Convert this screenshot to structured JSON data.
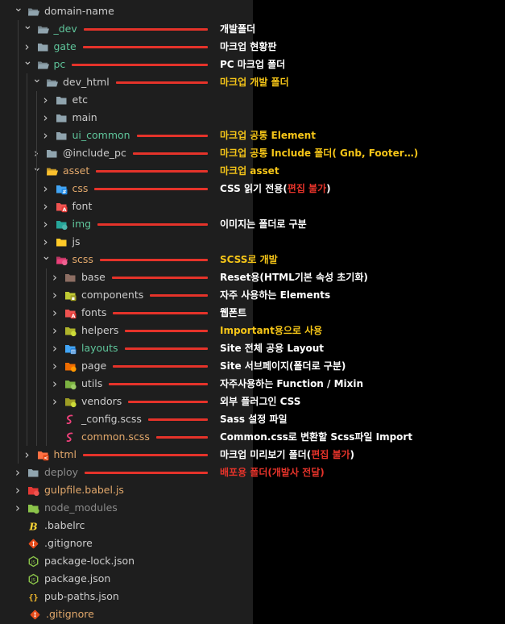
{
  "tree": [
    {
      "label": "domain-name",
      "depth": 0,
      "chevron": "down",
      "icon": "folder-open-icon",
      "label_color": "#cccccc"
    },
    {
      "label": "_dev",
      "depth": 1,
      "chevron": "down",
      "icon": "folder-open-icon",
      "label_color": "#5fc59b"
    },
    {
      "label": "gate",
      "depth": 1,
      "chevron": "right",
      "icon": "folder-icon",
      "label_color": "#5fc59b"
    },
    {
      "label": "pc",
      "depth": 1,
      "chevron": "down",
      "icon": "folder-open-icon",
      "label_color": "#5fc59b"
    },
    {
      "label": "dev_html",
      "depth": 2,
      "chevron": "down",
      "icon": "folder-open-icon",
      "label_color": "#cccccc"
    },
    {
      "label": "etc",
      "depth": 3,
      "chevron": "right",
      "icon": "folder-icon",
      "label_color": "#cccccc"
    },
    {
      "label": "main",
      "depth": 3,
      "chevron": "right",
      "icon": "folder-icon",
      "label_color": "#cccccc"
    },
    {
      "label": "ui_common",
      "depth": 3,
      "chevron": "right",
      "icon": "folder-icon",
      "label_color": "#5fc59b"
    },
    {
      "label": "@include_pc",
      "depth": 2,
      "chevron": "right",
      "icon": "folder-icon",
      "label_color": "#cccccc"
    },
    {
      "label": "asset",
      "depth": 2,
      "chevron": "down",
      "icon": "folder-asset-icon",
      "label_color": "#e2a86b"
    },
    {
      "label": "css",
      "depth": 3,
      "chevron": "right",
      "icon": "folder-css-icon",
      "label_color": "#e2a86b"
    },
    {
      "label": "font",
      "depth": 3,
      "chevron": "right",
      "icon": "folder-font-icon",
      "label_color": "#cccccc"
    },
    {
      "label": "img",
      "depth": 3,
      "chevron": "right",
      "icon": "folder-images-icon",
      "label_color": "#5fc59b"
    },
    {
      "label": "js",
      "depth": 3,
      "chevron": "right",
      "icon": "folder-js-icon",
      "label_color": "#cccccc"
    },
    {
      "label": "scss",
      "depth": 3,
      "chevron": "down",
      "icon": "folder-sass-icon",
      "label_color": "#e2a86b"
    },
    {
      "label": "base",
      "depth": 4,
      "chevron": "right",
      "icon": "folder-base-icon",
      "label_color": "#cccccc"
    },
    {
      "label": "components",
      "depth": 4,
      "chevron": "right",
      "icon": "folder-components-icon",
      "label_color": "#cccccc"
    },
    {
      "label": "fonts",
      "depth": 4,
      "chevron": "right",
      "icon": "folder-font-icon",
      "label_color": "#cccccc"
    },
    {
      "label": "helpers",
      "depth": 4,
      "chevron": "right",
      "icon": "folder-helper-icon",
      "label_color": "#cccccc"
    },
    {
      "label": "layouts",
      "depth": 4,
      "chevron": "right",
      "icon": "folder-layout-icon",
      "label_color": "#5fc59b"
    },
    {
      "label": "page",
      "depth": 4,
      "chevron": "right",
      "icon": "folder-page-icon",
      "label_color": "#cccccc"
    },
    {
      "label": "utils",
      "depth": 4,
      "chevron": "right",
      "icon": "folder-utils-icon",
      "label_color": "#cccccc"
    },
    {
      "label": "vendors",
      "depth": 4,
      "chevron": "right",
      "icon": "folder-vendor-icon",
      "label_color": "#cccccc"
    },
    {
      "label": "_config.scss",
      "depth": 4,
      "chevron": "none",
      "icon": "sass-file-icon",
      "label_color": "#cccccc"
    },
    {
      "label": "common.scss",
      "depth": 4,
      "chevron": "none",
      "icon": "sass-file-icon",
      "label_color": "#e2a86b"
    },
    {
      "label": "html",
      "depth": 1,
      "chevron": "right",
      "icon": "folder-html-icon",
      "label_color": "#e2a86b"
    },
    {
      "label": "deploy",
      "depth": 0,
      "chevron": "right",
      "icon": "folder-deploy-icon",
      "label_color": "#8a8a8a"
    },
    {
      "label": "gulpfile.babel.js",
      "depth": 0,
      "chevron": "right",
      "icon": "folder-gulp-icon",
      "label_color": "#e2a86b"
    },
    {
      "label": "node_modules",
      "depth": 0,
      "chevron": "right",
      "icon": "folder-node-icon",
      "label_color": "#8a8a8a"
    },
    {
      "label": ".babelrc",
      "depth": 0,
      "chevron": "none",
      "icon": "babel-icon",
      "label_color": "#cccccc"
    },
    {
      "label": ".gitignore",
      "depth": 0,
      "chevron": "none",
      "icon": "git-icon",
      "label_color": "#cccccc"
    },
    {
      "label": "package-lock.json",
      "depth": 0,
      "chevron": "none",
      "icon": "nodejs-icon",
      "label_color": "#cccccc"
    },
    {
      "label": "package.json",
      "depth": 0,
      "chevron": "none",
      "icon": "nodejs-icon",
      "label_color": "#cccccc"
    },
    {
      "label": "pub-paths.json",
      "depth": 0,
      "chevron": "none",
      "icon": "json-braces-icon",
      "label_color": "#cccccc"
    },
    {
      "label": ".gitignore",
      "depth": -1,
      "chevron": "none",
      "icon": "git-icon",
      "label_color": "#e2a86b"
    }
  ],
  "annotations": [
    {
      "row": 1,
      "parts": [
        {
          "text": "개발폴더",
          "color": "#ffffff"
        }
      ]
    },
    {
      "row": 2,
      "parts": [
        {
          "text": "마크업 현황판",
          "color": "#ffffff"
        }
      ]
    },
    {
      "row": 3,
      "parts": [
        {
          "text": "PC 마크업 폴더",
          "color": "#ffffff"
        }
      ]
    },
    {
      "row": 4,
      "parts": [
        {
          "text": "마크업 개발 폴더",
          "color": "#f5c518"
        }
      ]
    },
    {
      "row": 7,
      "parts": [
        {
          "text": "마크업 공통 Element",
          "color": "#f5c518"
        }
      ]
    },
    {
      "row": 8,
      "parts": [
        {
          "text": "마크업 공통 Include 폴더( Gnb, Footer…)",
          "color": "#f5c518"
        }
      ]
    },
    {
      "row": 9,
      "parts": [
        {
          "text": "마크업 asset",
          "color": "#f5c518"
        }
      ]
    },
    {
      "row": 10,
      "parts": [
        {
          "text": "CSS 읽기 전용(",
          "color": "#ffffff"
        },
        {
          "text": "편집 불가",
          "color": "#e5332a"
        },
        {
          "text": ")",
          "color": "#ffffff"
        }
      ]
    },
    {
      "row": 12,
      "parts": [
        {
          "text": "이미지는 폴더로 구분",
          "color": "#ffffff"
        }
      ]
    },
    {
      "row": 14,
      "parts": [
        {
          "text": "SCSS로 개발",
          "color": "#f5c518"
        }
      ]
    },
    {
      "row": 15,
      "parts": [
        {
          "text": "Reset용(HTML기본 속성 초기화)",
          "color": "#ffffff"
        }
      ]
    },
    {
      "row": 16,
      "parts": [
        {
          "text": "자주 사용하는 Elements",
          "color": "#ffffff"
        }
      ]
    },
    {
      "row": 17,
      "parts": [
        {
          "text": "웹폰트",
          "color": "#ffffff"
        }
      ]
    },
    {
      "row": 18,
      "parts": [
        {
          "text": "Important용으로 사용",
          "color": "#f5c518"
        }
      ]
    },
    {
      "row": 19,
      "parts": [
        {
          "text": "Site 전체 공용 Layout",
          "color": "#ffffff"
        }
      ]
    },
    {
      "row": 20,
      "parts": [
        {
          "text": "Site 서브페이지(폴더로 구분)",
          "color": "#ffffff"
        }
      ]
    },
    {
      "row": 21,
      "parts": [
        {
          "text": "자주사용하는 Function / Mixin",
          "color": "#ffffff"
        }
      ]
    },
    {
      "row": 22,
      "parts": [
        {
          "text": "외부 플러그인 CSS",
          "color": "#ffffff"
        }
      ]
    },
    {
      "row": 23,
      "parts": [
        {
          "text": "Sass 설정 파일",
          "color": "#ffffff"
        }
      ]
    },
    {
      "row": 24,
      "parts": [
        {
          "text": "Common.css로 변환할 Scss파일 Import",
          "color": "#ffffff"
        }
      ]
    },
    {
      "row": 25,
      "parts": [
        {
          "text": "마크업 미리보기 폴더(",
          "color": "#ffffff"
        },
        {
          "text": "편집 불가",
          "color": "#e5332a"
        },
        {
          "text": ")",
          "color": "#ffffff"
        }
      ]
    },
    {
      "row": 26,
      "parts": [
        {
          "text": "배포용 폴더(개발사 전달)",
          "color": "#e5332a"
        }
      ]
    }
  ],
  "colors": {
    "panel_bg": "#1e1e1e",
    "page_bg": "#000000",
    "marker_red": "#e5332a",
    "highlight_yellow": "#f5c518",
    "folder_grey": "#90a4ae"
  }
}
